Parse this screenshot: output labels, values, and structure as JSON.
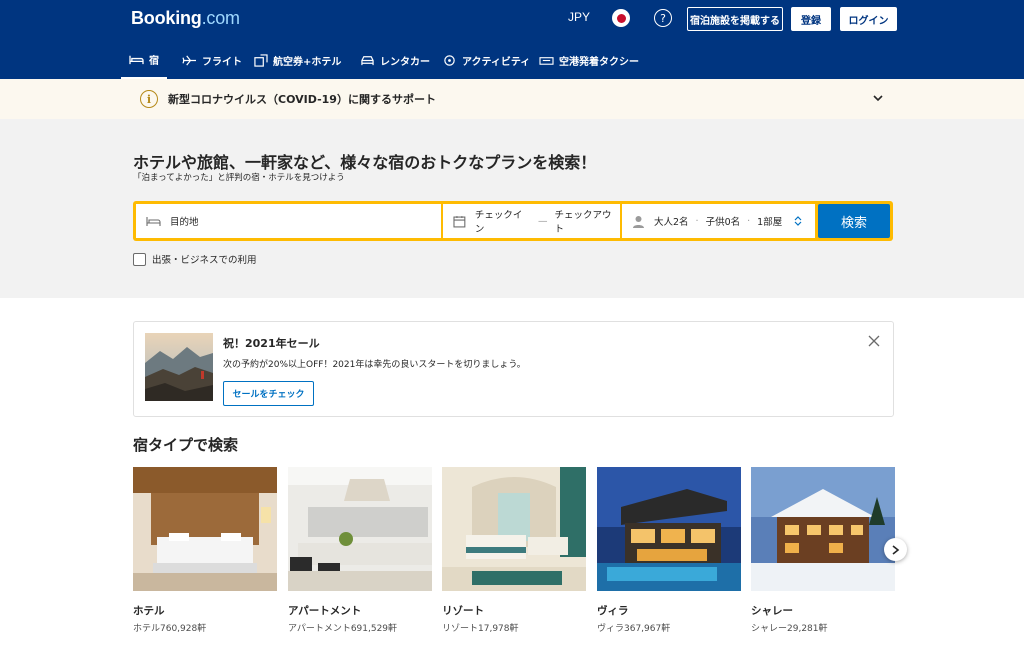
{
  "header": {
    "logo_main": "Booking",
    "logo_suffix": ".com",
    "currency": "JPY",
    "help": "?",
    "list_property": "宿泊施設を掲載する",
    "register": "登録",
    "login": "ログイン"
  },
  "nav": {
    "items": [
      {
        "label": "宿",
        "icon": "bed-icon"
      },
      {
        "label": "フライト",
        "icon": "plane-icon"
      },
      {
        "label": "航空券+ホテル",
        "icon": "flight-hotel-icon"
      },
      {
        "label": "レンタカー",
        "icon": "car-icon"
      },
      {
        "label": "アクティビティ",
        "icon": "attractions-icon"
      },
      {
        "label": "空港発着タクシー",
        "icon": "taxi-icon"
      }
    ]
  },
  "covid": {
    "icon": "i",
    "text": "新型コロナウイルス（COVID-19）に関するサポート"
  },
  "hero": {
    "title": "ホテルや旅館、一軒家など、様々な宿のおトクなプランを検索！",
    "subtitle": "「泊まってよかった」と評判の宿・ホテルを見つけよう",
    "destination_placeholder": "目的地",
    "checkin": "チェックイン",
    "date_sep": "—",
    "checkout": "チェックアウト",
    "adults": "大人2名",
    "children": "子供0名",
    "rooms": "1部屋",
    "dot": "·",
    "search_button": "検索",
    "business_label": "出張・ビジネスでの利用"
  },
  "promo": {
    "title": "祝！2021年セール",
    "description": "次の予約が20%以上OFF！2021年は幸先の良いスタートを切りましょう。",
    "button": "セールをチェック"
  },
  "property_section": {
    "title": "宿タイプで検索",
    "types": [
      {
        "name": "ホテル",
        "count": "ホテル760,928軒"
      },
      {
        "name": "アパートメント",
        "count": "アパートメント691,529軒"
      },
      {
        "name": "リゾート",
        "count": "リゾート17,978軒"
      },
      {
        "name": "ヴィラ",
        "count": "ヴィラ367,967軒"
      },
      {
        "name": "シャレー",
        "count": "シャレー29,281軒"
      }
    ]
  },
  "colors": {
    "brand_blue": "#003580",
    "accent_blue": "#0071c2",
    "search_yellow": "#febb02"
  }
}
